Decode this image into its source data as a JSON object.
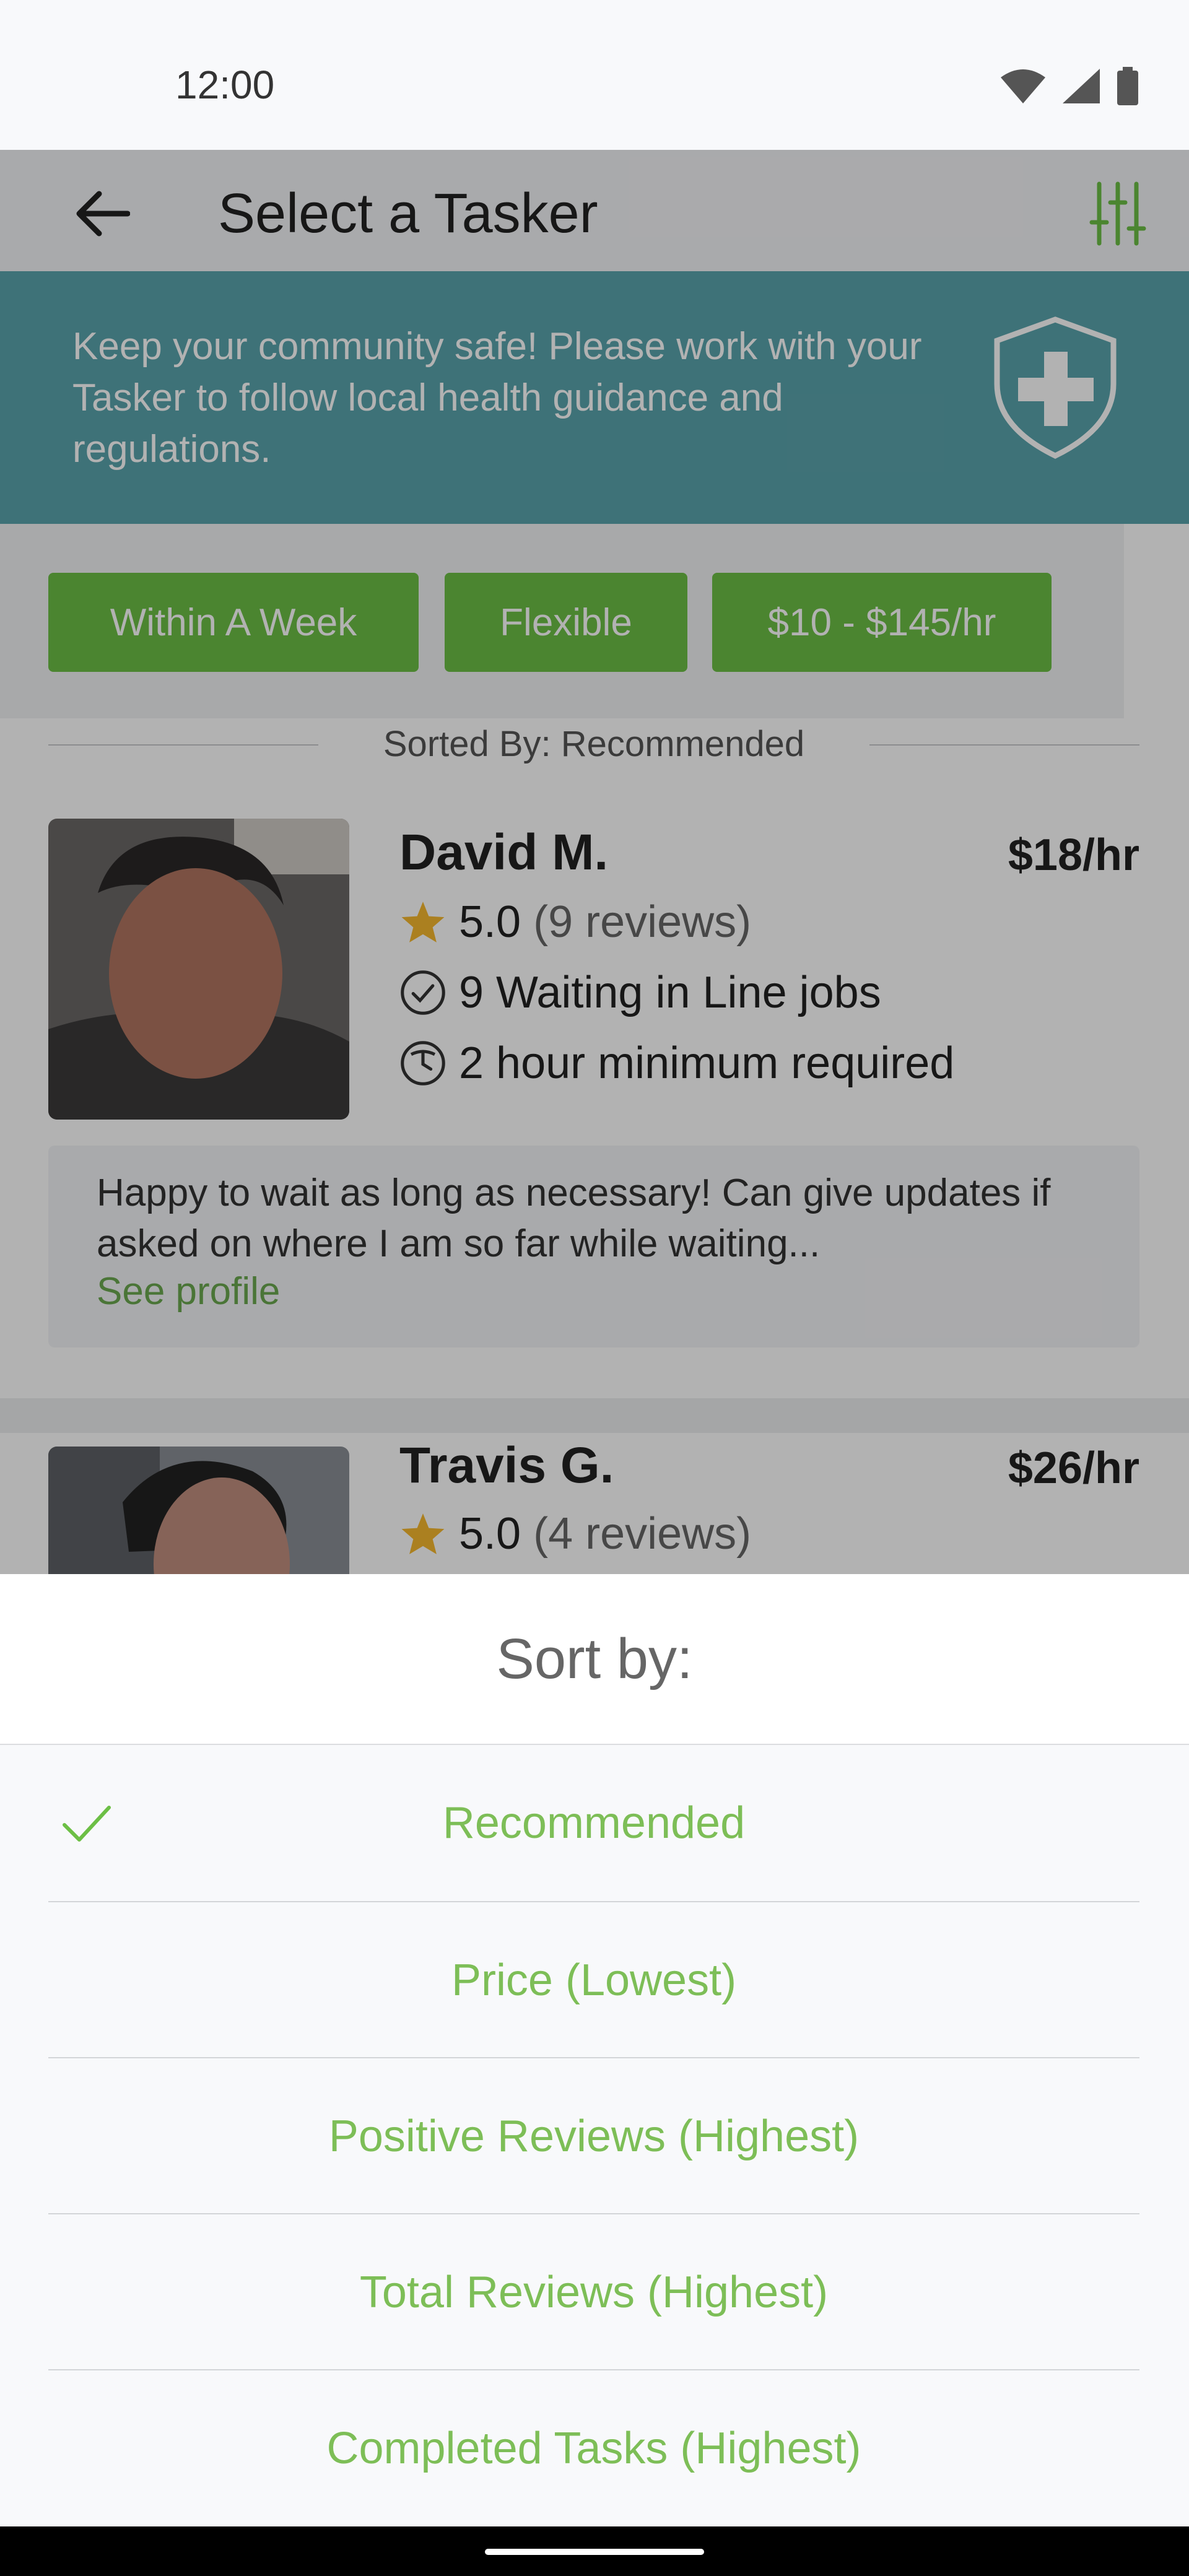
{
  "status_bar": {
    "time": "12:00",
    "icons": [
      "wifi-icon",
      "signal-icon",
      "battery-icon"
    ]
  },
  "app_bar": {
    "title": "Select a Tasker",
    "back_icon": "arrow-left-icon",
    "filter_icon": "sliders-icon"
  },
  "banner": {
    "text": "Keep your community safe! Please work with your Tasker to follow local health guidance and regulations.",
    "icon": "shield-cross-icon"
  },
  "filters": [
    "Within A Week",
    "Flexible",
    "$10 - $145/hr"
  ],
  "sorted_by": "Sorted By: Recommended",
  "taskers": [
    {
      "name": "David M.",
      "rate": "$18/hr",
      "rating": "5.0",
      "reviews": "(9 reviews)",
      "jobs": "9 Waiting in Line jobs",
      "minimum": "2 hour minimum required",
      "bio": "Happy to wait as long as necessary! Can give updates if asked on where I am so far while waiting...",
      "link": "See profile"
    },
    {
      "name": "Travis G.",
      "rate": "$26/hr",
      "rating": "5.0",
      "reviews": "(4 reviews)"
    }
  ],
  "sort_sheet": {
    "title": "Sort by:",
    "options": [
      "Recommended",
      "Price (Lowest)",
      "Positive Reviews (Highest)",
      "Total Reviews (Highest)",
      "Completed Tasks (Highest)"
    ],
    "selected": "Recommended"
  },
  "colors": {
    "accent_green": "#6cbf45",
    "option_text": "#7dbe57",
    "banner_teal": "#5aa4ac",
    "star": "#f5b82e"
  }
}
